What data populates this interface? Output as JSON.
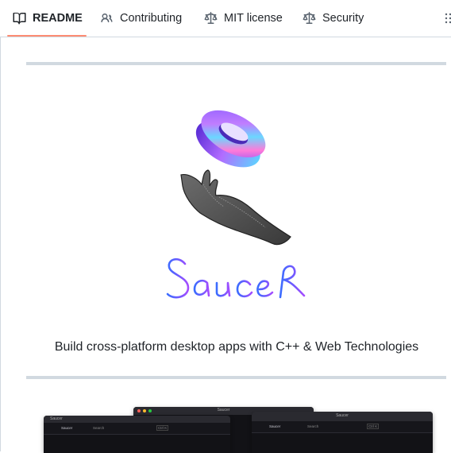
{
  "tabs": [
    {
      "label": "README",
      "icon": "book-icon",
      "active": true
    },
    {
      "label": "Contributing",
      "icon": "people-icon",
      "active": false
    },
    {
      "label": "MIT license",
      "icon": "scale-icon",
      "active": false
    },
    {
      "label": "Security",
      "icon": "scale-icon",
      "active": false
    }
  ],
  "readme": {
    "logo_text": "Saucer",
    "tagline": "Build cross-platform desktop apps with C++ & Web Technologies"
  },
  "screenshots": {
    "window_title_1": "Saucer",
    "window_title_2": "Saucer",
    "app_name": "Saucer",
    "search_placeholder": "Search",
    "shortcut": "Ctrl K"
  },
  "colors": {
    "tab_underline": "#fd8c73",
    "divider": "#d1d9e0",
    "text": "#1f2328",
    "accent_blue": "#3b6dff",
    "accent_purple": "#a64dff"
  }
}
